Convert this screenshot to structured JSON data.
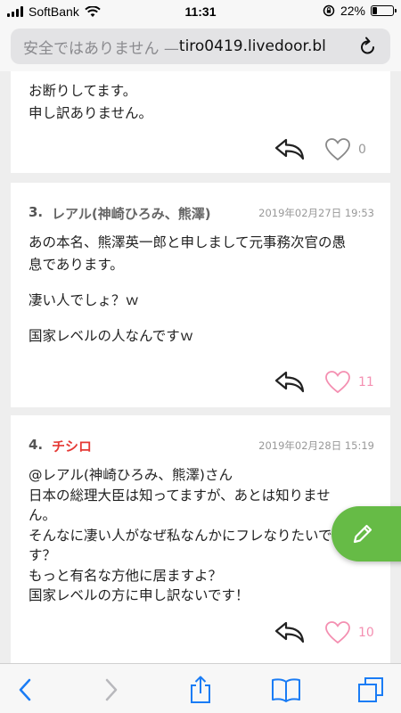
{
  "status": {
    "carrier": "SoftBank",
    "time": "11:31",
    "battery_text": "22%",
    "battery_level": 0.22
  },
  "url_bar": {
    "insecure_label": "安全ではありません —",
    "host": " tiro0419.livedoor.bl"
  },
  "comments": [
    {
      "lines": [
        "お断りしてます。",
        "申し訳ありません。"
      ],
      "likes": "0",
      "liked": false
    },
    {
      "number": "3.",
      "author": "レアル(神崎ひろみ、熊澤)",
      "date": "2019年02月27日 19:53",
      "lines": [
        "あの本名、熊澤英一郎と申しまして元事務次官の愚",
        "息であります。",
        "",
        "凄い人でしょ？ｗ",
        "",
        "国家レベルの人なんですｗ"
      ],
      "likes": "11",
      "liked": true
    },
    {
      "number": "4.",
      "author": "チシロ",
      "date": "2019年02月28日 15:19",
      "lines": [
        "@レアル(神崎ひろみ、熊澤)さん",
        "日本の総理大臣は知ってますが、あとは知りませ",
        "ん。",
        "そんなに凄い人がなぜ私なんかにフレなりたいで",
        "す？",
        "もっと有名な方他に居ますよ？",
        "国家レベルの方に申し訳ないです！"
      ],
      "likes": "10",
      "liked": true
    }
  ],
  "colors": {
    "author_red": "#e53935",
    "fab_green": "#66bb46",
    "heart_pink": "#f48fb1",
    "ios_blue": "#1a7cf5"
  }
}
